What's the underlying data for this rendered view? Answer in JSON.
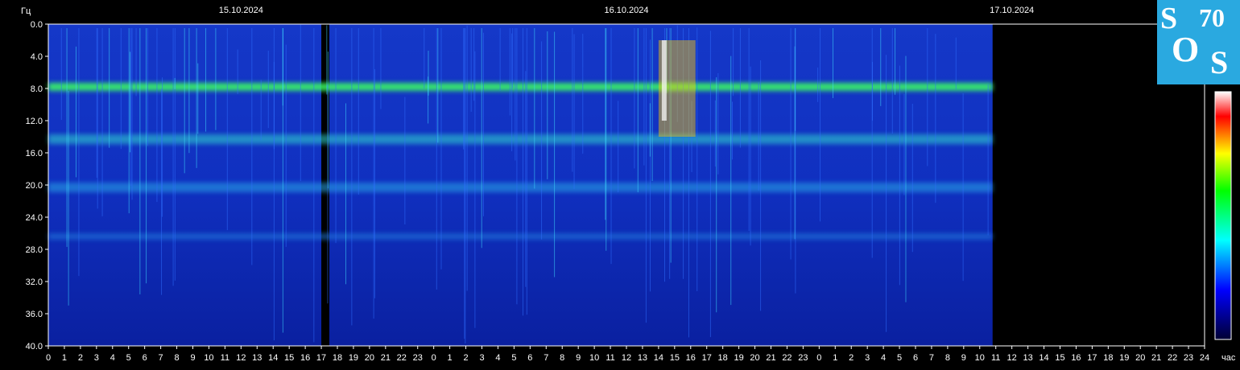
{
  "chart_data": {
    "type": "heatmap",
    "title": "",
    "ylabel": "Гц",
    "xlabel": "час",
    "ylim": [
      0,
      40
    ],
    "y_ticks": [
      "0.0",
      "4.0",
      "8.0",
      "12.0",
      "16.0",
      "20.0",
      "24.0",
      "28.0",
      "32.0",
      "36.0",
      "40.0"
    ],
    "x_ticks": [
      "0",
      "1",
      "2",
      "3",
      "4",
      "5",
      "6",
      "7",
      "8",
      "9",
      "10",
      "11",
      "12",
      "13",
      "14",
      "15",
      "16",
      "17",
      "18",
      "19",
      "20",
      "21",
      "22",
      "23",
      "0",
      "1",
      "2",
      "3",
      "4",
      "5",
      "6",
      "7",
      "8",
      "9",
      "10",
      "11",
      "12",
      "13",
      "14",
      "15",
      "16",
      "17",
      "18",
      "19",
      "20",
      "21",
      "22",
      "23",
      "0",
      "1",
      "2",
      "3",
      "4",
      "5",
      "6",
      "7",
      "8",
      "9",
      "10",
      "11",
      "12",
      "13",
      "14",
      "15",
      "16",
      "17",
      "18",
      "19",
      "20",
      "21",
      "22",
      "23",
      "24"
    ],
    "dates": [
      "15.10.2024",
      "16.10.2024",
      "17.10.2024"
    ],
    "x_range_hours": [
      0,
      72
    ],
    "data_end_hour": 58.8,
    "gap_hours": [
      17.0,
      17.5
    ],
    "bands_hz": [
      7.8,
      14.3,
      20.3,
      26.4
    ],
    "colorbar": [
      "#000033",
      "#0000ff",
      "#00ffff",
      "#00ff00",
      "#ffff00",
      "#ff0000",
      "#ffffff"
    ]
  },
  "logo": {
    "s1": "S",
    "n": "70",
    "o": "O",
    "s2": "S"
  }
}
